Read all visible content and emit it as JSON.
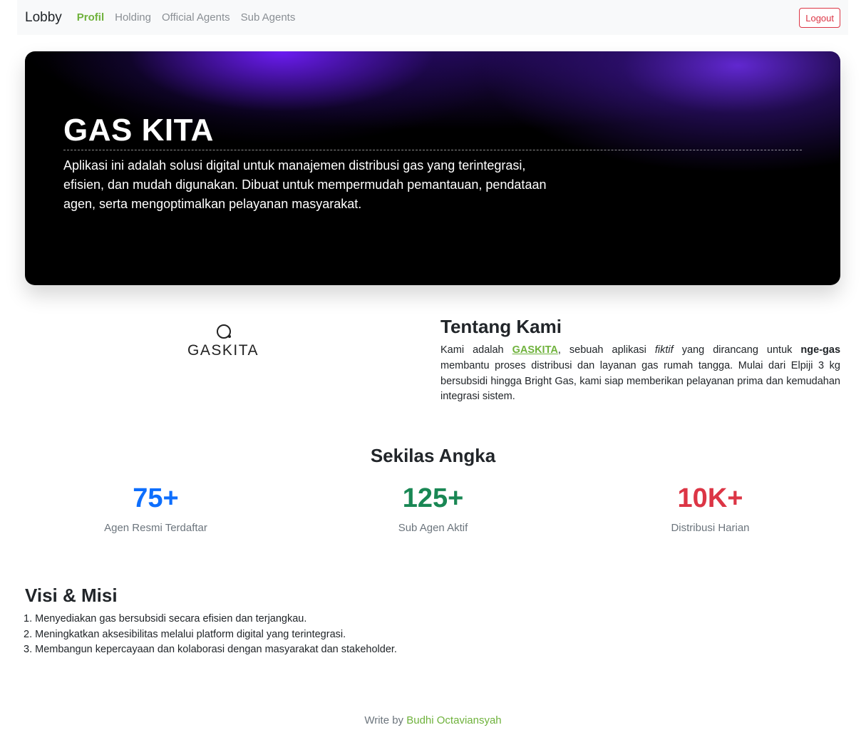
{
  "navbar": {
    "brand": "Lobby",
    "links": [
      "Profil",
      "Holding",
      "Official Agents",
      "Sub Agents"
    ],
    "logout": "Logout"
  },
  "hero": {
    "title": "GAS KITA",
    "description": "Aplikasi ini adalah solusi digital untuk manajemen distribusi gas yang terintegrasi, efisien, dan mudah digunakan. Dibuat untuk mempermudah pemantauan, pendataan agen, serta mengoptimalkan pelayanan masyarakat."
  },
  "about": {
    "logo_text": "GASKITA",
    "title": "Tentang Kami",
    "p1": "Kami adalah ",
    "brand": "GASKITA",
    "p2": ", sebuah aplikasi ",
    "italic": "fiktif",
    "p3": " yang dirancang untuk ",
    "bold": "nge-gas",
    "p4": " membantu proses distribusi dan layanan gas rumah tangga. Mulai dari Elpiji 3 kg bersubsidi hingga Bright Gas, kami siap memberikan pelayanan prima dan kemudahan integrasi sistem."
  },
  "stats": {
    "title": "Sekilas Angka",
    "items": [
      {
        "value": "75+",
        "label": "Agen Resmi Terdaftar",
        "color": "#0d6efd"
      },
      {
        "value": "125+",
        "label": "Sub Agen Aktif",
        "color": "#198754"
      },
      {
        "value": "10K+",
        "label": "Distribusi Harian",
        "color": "#dc3545"
      }
    ]
  },
  "vision": {
    "title": "Visi & Misi",
    "items": [
      "1. Menyediakan gas bersubsidi secara efisien dan terjangkau.",
      "2. Meningkatkan aksesibilitas melalui platform digital yang terintegrasi.",
      "3. Membangun kepercayaan dan kolaborasi dengan masyarakat dan stakeholder."
    ]
  },
  "footer": {
    "prefix": "Write by ",
    "author": "Budhi Octaviansyah"
  },
  "colors": {
    "accent": "#6fb23c",
    "danger": "#dc3545"
  }
}
